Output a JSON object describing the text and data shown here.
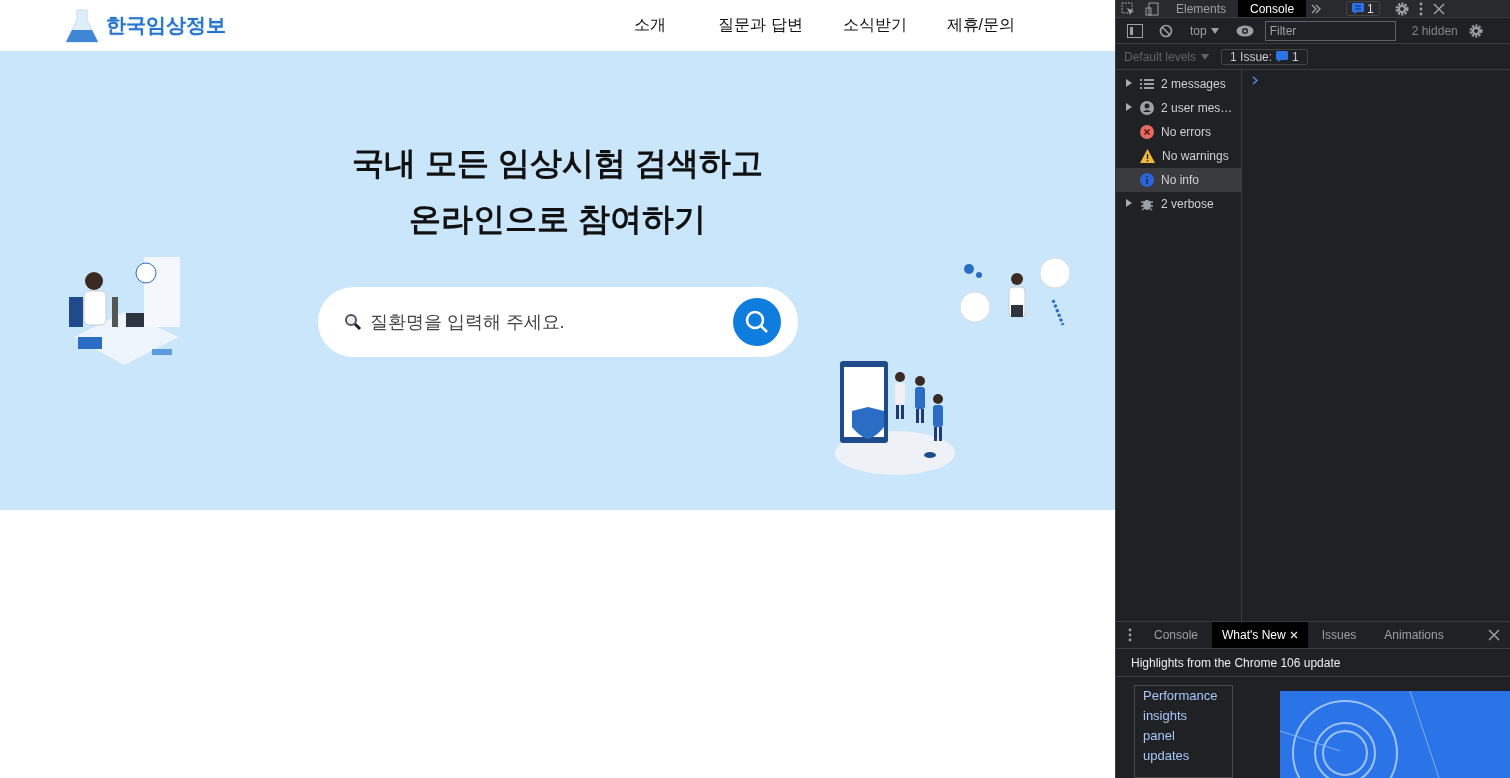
{
  "site": {
    "logo": "한국임상정보",
    "nav": [
      {
        "label": "소개"
      },
      {
        "label": "질문과 답변"
      },
      {
        "label": "소식받기"
      },
      {
        "label": "제휴/문의"
      }
    ]
  },
  "hero": {
    "title_lines": [
      "국내 모든 임상시험 검색하고",
      "온라인으로 참여하기"
    ],
    "search": {
      "placeholder": "질환명을 입력해 주세요."
    }
  },
  "devtools": {
    "tabs": [
      {
        "label": "Elements",
        "selected": false
      },
      {
        "label": "Console",
        "selected": true
      }
    ],
    "issues_badge": "1",
    "toolbar": {
      "context": "top",
      "filter_placeholder": "Filter",
      "hidden_count": "2 hidden"
    },
    "levels": {
      "label": "Default levels",
      "issues_label": "1 Issue:",
      "issues_count": "1"
    },
    "sidebar": [
      {
        "kind": "messages",
        "label": "2 messages",
        "expandable": true,
        "selected": false
      },
      {
        "kind": "user",
        "label": "2 user mes…",
        "expandable": true,
        "selected": false
      },
      {
        "kind": "error",
        "label": "No errors",
        "expandable": false,
        "selected": false
      },
      {
        "kind": "warning",
        "label": "No warnings",
        "expandable": false,
        "selected": false
      },
      {
        "kind": "info",
        "label": "No info",
        "expandable": false,
        "selected": true
      },
      {
        "kind": "verbose",
        "label": "2 verbose",
        "expandable": true,
        "selected": false
      }
    ],
    "drawer": {
      "tabs": [
        {
          "label": "Console",
          "selected": false,
          "closable": false
        },
        {
          "label": "What's New",
          "selected": true,
          "closable": true
        },
        {
          "label": "Issues",
          "selected": false,
          "closable": false
        },
        {
          "label": "Animations",
          "selected": false,
          "closable": false
        }
      ],
      "headline": "Highlights from the Chrome 106 update",
      "links": [
        "Performance",
        "insights",
        "panel",
        "updates"
      ]
    }
  }
}
